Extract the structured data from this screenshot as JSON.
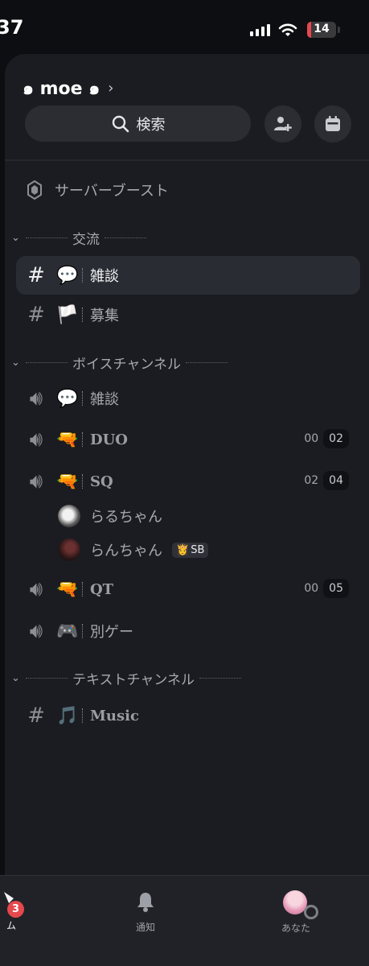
{
  "status_bar": {
    "time": "37",
    "battery": "14",
    "battery_level": 0.14,
    "battery_color": "#e5484d"
  },
  "server": {
    "name": "๑ moe ๑",
    "search_label": "検索"
  },
  "boost": {
    "label": "サーバーブースト"
  },
  "categories": [
    {
      "name": "交流"
    },
    {
      "name": "ボイスチャンネル"
    },
    {
      "name": "テキストチャンネル"
    }
  ],
  "channels": [
    {
      "type": "text",
      "emoji": "💬",
      "name": "雑談",
      "active": true
    },
    {
      "type": "text",
      "emoji": "🏳️",
      "name": "募集"
    },
    {
      "type": "voice",
      "emoji": "💬",
      "name": "雑談"
    },
    {
      "type": "voice",
      "emoji": "🔫",
      "name": "DUO",
      "count": "00",
      "limit": "02"
    },
    {
      "type": "voice",
      "emoji": "🔫",
      "name": "SQ",
      "count": "02",
      "limit": "04"
    },
    {
      "type": "voice",
      "emoji": "🔫",
      "name": "QT",
      "count": "00",
      "limit": "05"
    },
    {
      "type": "voice",
      "emoji": "🎮",
      "name": "別ゲー"
    },
    {
      "type": "text",
      "emoji": "🎵",
      "name": "Music"
    }
  ],
  "voice_users": [
    {
      "name": "らるちゃん"
    },
    {
      "name": "らんちゃん",
      "badge_label": "SB",
      "badge_icon": "👸"
    }
  ],
  "tabs": [
    {
      "label": "ム",
      "badge": "3"
    },
    {
      "label": "通知"
    },
    {
      "label": "あなた"
    }
  ],
  "colors": {
    "accent_red": "#e5484d",
    "bg": "#1b1c21"
  }
}
